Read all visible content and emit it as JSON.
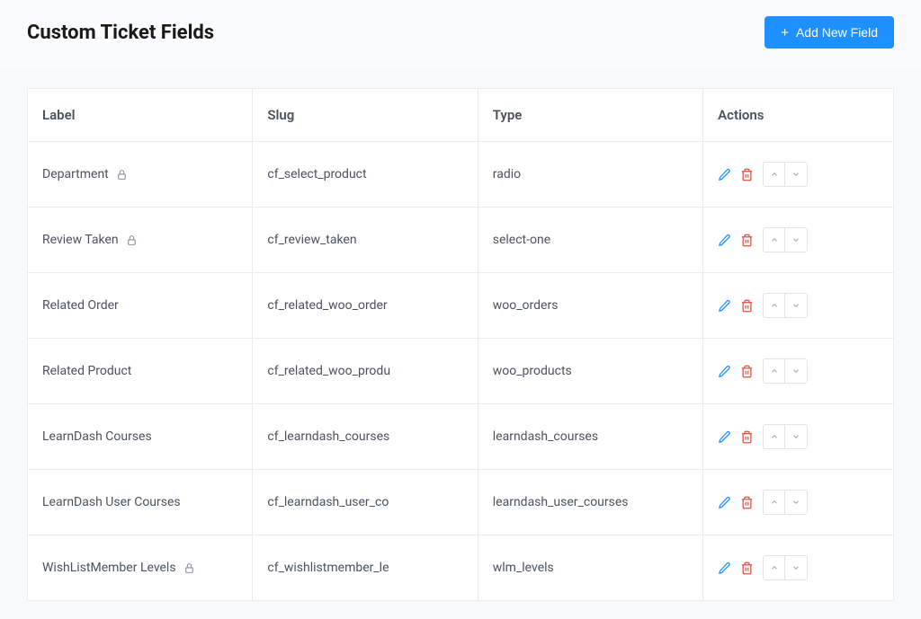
{
  "header": {
    "title": "Custom Ticket Fields",
    "add_button_label": "Add New Field"
  },
  "table": {
    "columns": {
      "label": "Label",
      "slug": "Slug",
      "type": "Type",
      "actions": "Actions"
    },
    "rows": [
      {
        "label": "Department",
        "locked": true,
        "slug": "cf_select_product",
        "type": "radio"
      },
      {
        "label": "Review Taken",
        "locked": true,
        "slug": "cf_review_taken",
        "type": "select-one"
      },
      {
        "label": "Related Order",
        "locked": false,
        "slug": "cf_related_woo_order",
        "type": "woo_orders"
      },
      {
        "label": "Related Product",
        "locked": false,
        "slug": "cf_related_woo_produ",
        "type": "woo_products"
      },
      {
        "label": "LearnDash Courses",
        "locked": false,
        "slug": "cf_learndash_courses",
        "type": "learndash_courses"
      },
      {
        "label": "LearnDash User Courses",
        "locked": false,
        "slug": "cf_learndash_user_co",
        "type": "learndash_user_courses"
      },
      {
        "label": "WishListMember Levels",
        "locked": true,
        "slug": "cf_wishlistmember_le",
        "type": "wlm_levels"
      }
    ]
  },
  "colors": {
    "primary": "#1e90ff",
    "danger": "#e74c3c",
    "arrow": "#a0a8b0"
  }
}
